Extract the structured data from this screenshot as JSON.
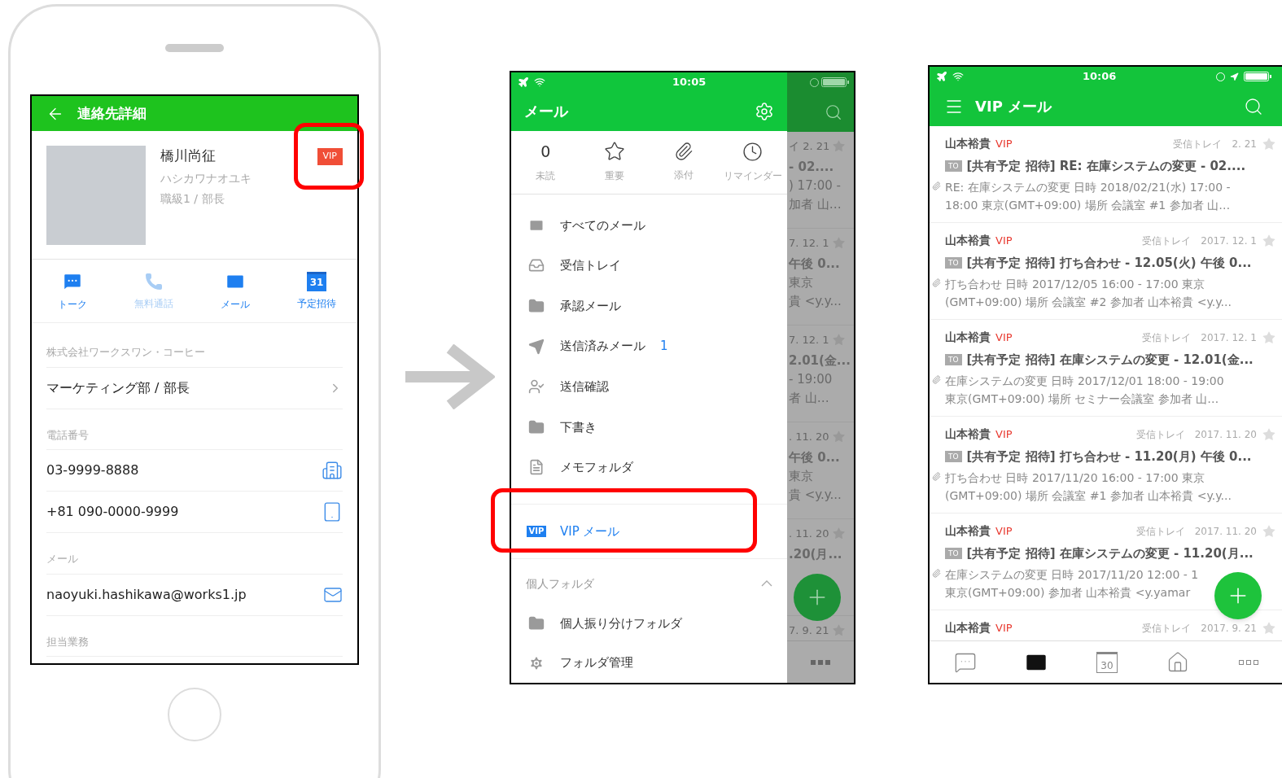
{
  "contact_screen": {
    "title": "連絡先詳細",
    "profile": {
      "name": "橋川尚征",
      "kana": "ハシカワナオユキ",
      "position": "職級1 / 部長",
      "badge": "VIP"
    },
    "actions": [
      {
        "kind": "talk",
        "label": "トーク",
        "disabled": false
      },
      {
        "kind": "call",
        "label": "無料通話",
        "disabled": true
      },
      {
        "kind": "mail",
        "label": "メール",
        "disabled": false
      },
      {
        "kind": "calendar",
        "icon_text": "31",
        "label": "予定招待",
        "disabled": false
      }
    ],
    "sections": [
      {
        "label": "株式会社ワークスワン・コーヒー",
        "rows": [
          {
            "kind": "link",
            "value": "マーケティング部 / 部長"
          }
        ]
      },
      {
        "label": "電話番号",
        "rows": [
          {
            "kind": "office",
            "value": "03-9999-8888"
          },
          {
            "kind": "mobile",
            "value": "+81 090-0000-9999"
          }
        ]
      },
      {
        "label": "メール",
        "rows": [
          {
            "kind": "email",
            "value": "naoyuki.hashikawa@works1.jp"
          }
        ]
      },
      {
        "label": "担当業務"
      }
    ]
  },
  "drawer_screen": {
    "status_bar": {
      "time": "10:05"
    },
    "title": "メール",
    "quick_filters": [
      {
        "kind": "count",
        "value": "0",
        "label": "未読"
      },
      {
        "kind": "star",
        "label": "重要"
      },
      {
        "kind": "attachment",
        "label": "添付"
      },
      {
        "kind": "reminder",
        "label": "リマインダー"
      }
    ],
    "folders": [
      {
        "kind": "mail",
        "label": "すべてのメール",
        "selected": false
      },
      {
        "kind": "inbox",
        "label": "受信トレイ",
        "selected": false
      },
      {
        "kind": "folder",
        "label": "承認メール",
        "selected": false
      },
      {
        "kind": "sent",
        "label": "送信済みメール",
        "count": "1",
        "selected": false
      },
      {
        "kind": "sent-check",
        "label": "送信確認",
        "selected": false
      },
      {
        "kind": "drafts",
        "label": "下書き",
        "selected": false
      },
      {
        "kind": "memo",
        "label": "メモフォルダ",
        "selected": false
      },
      {
        "kind": "vip",
        "icon_text": "VIP",
        "label": "VIP メール",
        "selected": true
      }
    ],
    "personal_section": {
      "label": "個人フォルダ",
      "expanded": true,
      "folders": [
        {
          "kind": "folder",
          "label": "個人振り分けフォルダ",
          "selected": false
        }
      ]
    },
    "manage": {
      "label": "フォルダ管理"
    },
    "background_list": [
      {
        "date": "イ 2. 21",
        "lines": [
          "- 02....",
          ") 17:00 -",
          "加者 山…"
        ]
      },
      {
        "date": "7. 12. 1",
        "lines": [
          "午後 0...",
          "東京",
          "貴 <y.y..."
        ]
      },
      {
        "date": "7. 12. 1",
        "lines": [
          "2.01(金...",
          "- 19:00",
          "者 山…"
        ]
      },
      {
        "date": ". 11. 20",
        "lines": [
          "午後 0...",
          "東京",
          "貴 <y.y..."
        ]
      },
      {
        "date": ". 11. 20",
        "lines": [
          ".20(月..."
        ]
      },
      {
        "date": "7. 9. 21"
      }
    ]
  },
  "mail_list_screen": {
    "status_bar": {
      "time": "10:06"
    },
    "title": "VIP メール",
    "messages": [
      {
        "sender": "山本裕貴",
        "tag": "VIP",
        "folder": "受信トレイ",
        "date": "2. 21",
        "starred": false,
        "badge": "TO",
        "subject": "[共有予定 招待] RE: 在庫システムの変更 - 02....",
        "attachment": true,
        "preview": [
          "RE: 在庫システムの変更 日時 2018/02/21(水) 17:00 -",
          "18:00 東京(GMT+09:00) 場所 会議室 #1 参加者 山…"
        ]
      },
      {
        "sender": "山本裕貴",
        "tag": "VIP",
        "folder": "受信トレイ",
        "date": "2017. 12. 1",
        "starred": false,
        "badge": "TO",
        "subject": "[共有予定 招待] 打ち合わせ - 12.05(火) 午後 0...",
        "attachment": true,
        "preview": [
          "打ち合わせ 日時 2017/12/05 16:00 - 17:00 東京",
          "(GMT+09:00) 場所 会議室 #2 参加者 山本裕貴 <y.y..."
        ]
      },
      {
        "sender": "山本裕貴",
        "tag": "VIP",
        "folder": "受信トレイ",
        "date": "2017. 12. 1",
        "starred": false,
        "badge": "TO",
        "subject": "[共有予定 招待] 在庫システムの変更 - 12.01(金...",
        "attachment": true,
        "preview": [
          "在庫システムの変更 日時 2017/12/01 18:00 - 19:00",
          "東京(GMT+09:00) 場所 セミナー会議室 参加者 山…"
        ]
      },
      {
        "sender": "山本裕貴",
        "tag": "VIP",
        "folder": "受信トレイ",
        "date": "2017. 11. 20",
        "starred": false,
        "badge": "TO",
        "subject": "[共有予定 招待] 打ち合わせ - 11.20(月) 午後 0...",
        "attachment": true,
        "preview": [
          "打ち合わせ 日時 2017/11/20 16:00 - 17:00 東京",
          "(GMT+09:00) 場所 会議室 #1 参加者 山本裕貴 <y.y..."
        ]
      },
      {
        "sender": "山本裕貴",
        "tag": "VIP",
        "folder": "受信トレイ",
        "date": "2017. 11. 20",
        "starred": false,
        "badge": "TO",
        "subject": "[共有予定 招待] 在庫システムの変更 - 11.20(月...",
        "attachment": true,
        "preview": [
          "在庫システムの変更 日時 2017/11/20 12:00 - 1",
          "東京(GMT+09:00) 参加者 山本裕貴 <y.yamar"
        ]
      },
      {
        "sender": "山本裕貴",
        "tag": "VIP",
        "folder": "受信トレイ",
        "date": "2017. 9. 21",
        "starred": false
      }
    ],
    "tabs": [
      {
        "kind": "chat",
        "selected": false
      },
      {
        "kind": "mail",
        "selected": true
      },
      {
        "kind": "calendar",
        "icon_text": "30",
        "selected": false
      },
      {
        "kind": "home",
        "selected": false
      },
      {
        "kind": "more",
        "selected": false
      }
    ]
  }
}
